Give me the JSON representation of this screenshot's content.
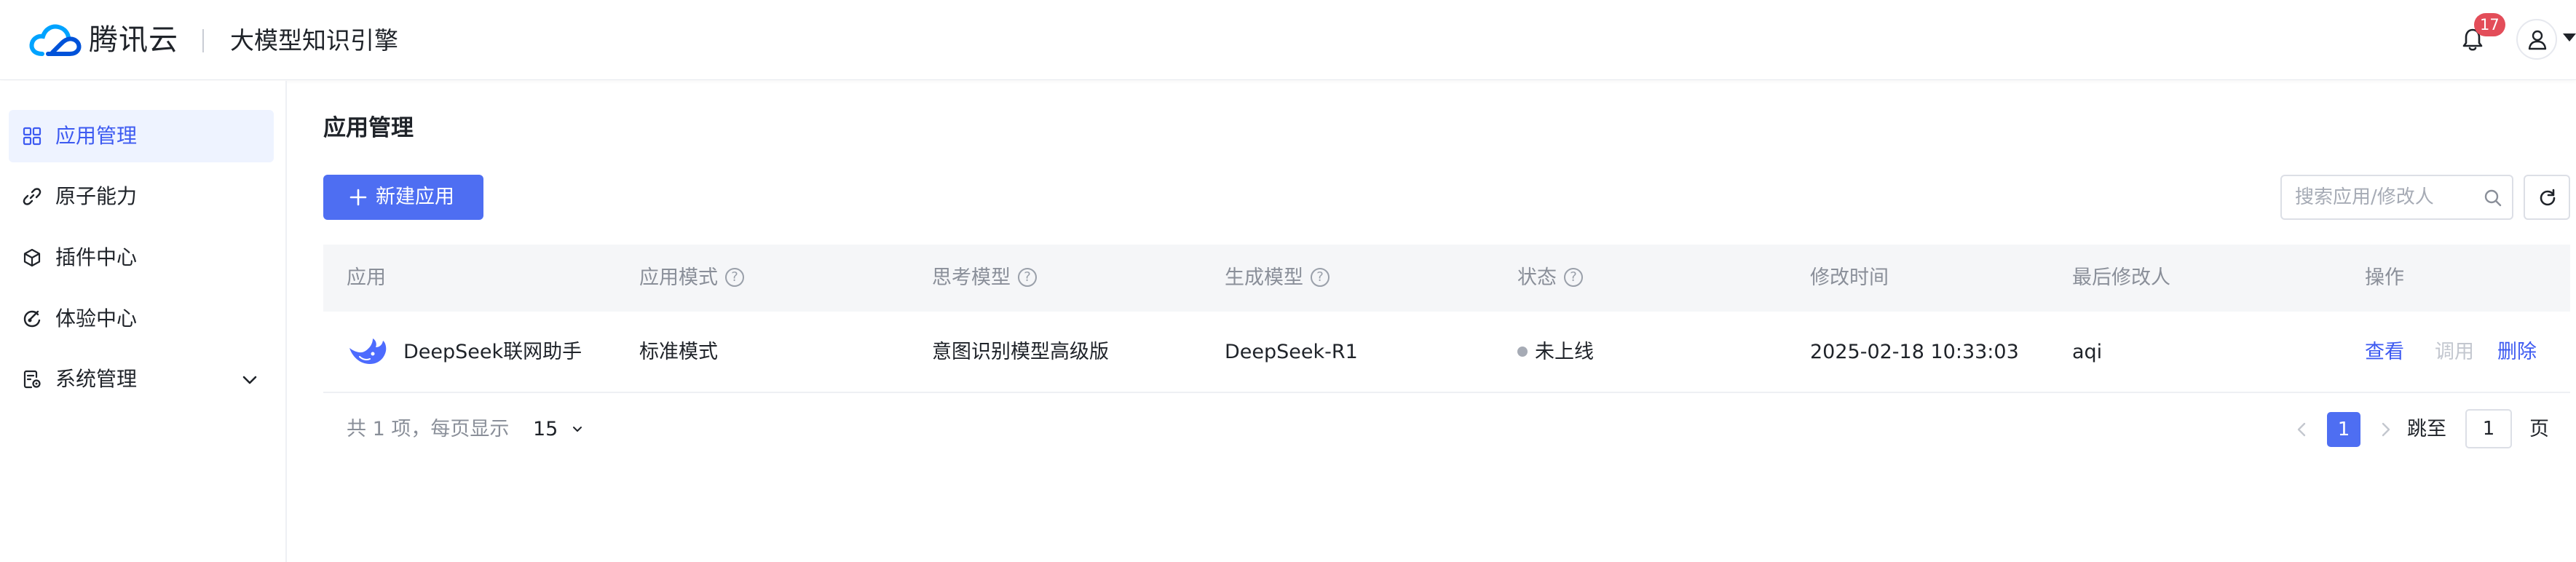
{
  "header": {
    "brand": "腾讯云",
    "product": "大模型知识引擎",
    "notification_count": "17"
  },
  "sidebar": {
    "items": [
      {
        "label": "应用管理",
        "icon": "grid-icon",
        "active": true
      },
      {
        "label": "原子能力",
        "icon": "link-icon"
      },
      {
        "label": "插件中心",
        "icon": "cube-icon"
      },
      {
        "label": "体验中心",
        "icon": "experience-icon"
      },
      {
        "label": "系统管理",
        "icon": "settings-doc-icon",
        "expandable": true
      }
    ]
  },
  "main": {
    "title": "应用管理",
    "new_button": "新建应用",
    "search_placeholder": "搜索应用/修改人"
  },
  "table": {
    "columns": [
      "应用",
      "应用模式",
      "思考模型",
      "生成模型",
      "状态",
      "修改时间",
      "最后修改人",
      "操作"
    ],
    "rows": [
      {
        "app": "DeepSeek联网助手",
        "mode": "标准模式",
        "thinking_model": "意图识别模型高级版",
        "generation_model": "DeepSeek-R1",
        "status": "未上线",
        "modified_time": "2025-02-18 10:33:03",
        "last_modifier": "aqi",
        "actions": {
          "view": "查看",
          "call": "调用",
          "delete": "删除"
        }
      }
    ]
  },
  "pagination": {
    "total_text": "共 1 项，每页显示",
    "page_size": "15",
    "current_page": "1",
    "jump_label": "跳至",
    "jump_value": "1",
    "page_suffix": "页"
  },
  "colors": {
    "primary": "#4e6ef2",
    "link": "#3d5af1",
    "badge": "#e34d59",
    "status_offline": "#a6abb5"
  }
}
